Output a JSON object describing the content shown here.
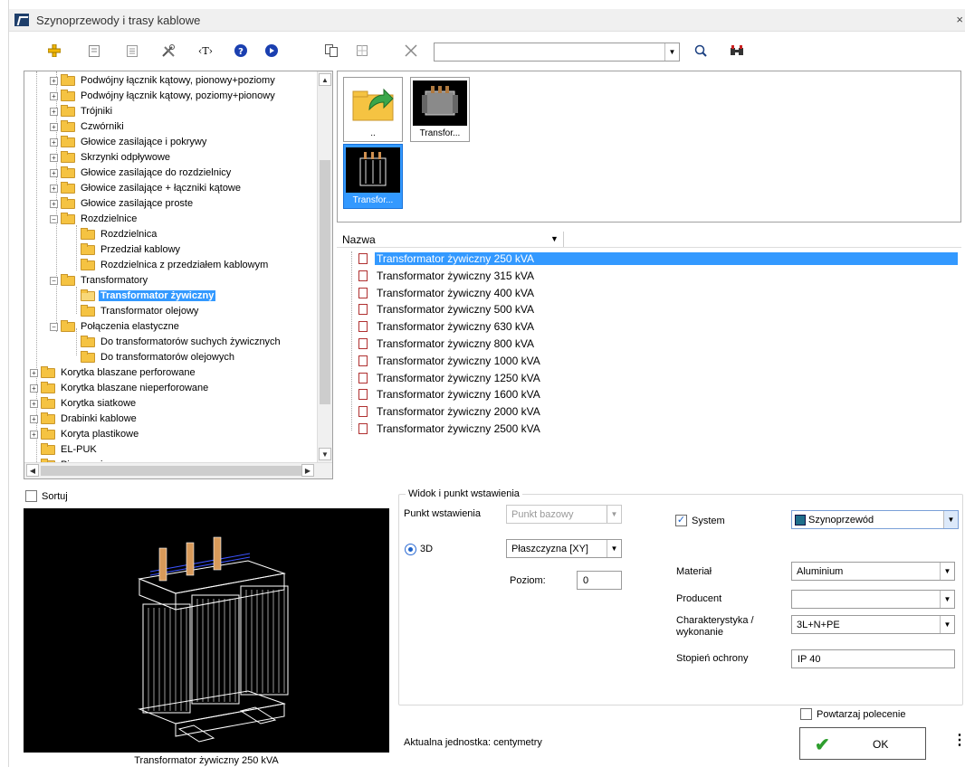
{
  "window": {
    "title": "Szynoprzewody i trasy kablowe",
    "close_glyph": "×"
  },
  "toolbar": {
    "icons": [
      "add-icon",
      "page-icon",
      "list-icon",
      "tools-icon",
      "text-tag-icon",
      "help-icon",
      "info-icon",
      "copy-icon",
      "grid-icon",
      "delete-icon",
      "search-icon",
      "binoculars-icon"
    ],
    "text_tag": "‹T›",
    "search_value": ""
  },
  "tree": {
    "items": [
      {
        "label": "Podwójny łącznik kątowy, pionowy+poziomy",
        "level": 1,
        "expander": "+"
      },
      {
        "label": "Podwójny łącznik kątowy, poziomy+pionowy",
        "level": 1,
        "expander": "+"
      },
      {
        "label": "Trójniki",
        "level": 1,
        "expander": "+"
      },
      {
        "label": "Czwórniki",
        "level": 1,
        "expander": "+"
      },
      {
        "label": "Głowice zasilające i pokrywy",
        "level": 1,
        "expander": "+"
      },
      {
        "label": "Skrzynki odpływowe",
        "level": 1,
        "expander": "+"
      },
      {
        "label": "Głowice zasilające do rozdzielnicy",
        "level": 1,
        "expander": "+"
      },
      {
        "label": "Głowice zasilające + łączniki kątowe",
        "level": 1,
        "expander": "+"
      },
      {
        "label": "Głowice zasilające proste",
        "level": 1,
        "expander": "+"
      },
      {
        "label": "Rozdzielnice",
        "level": 1,
        "expander": "−"
      },
      {
        "label": "Rozdzielnica",
        "level": 2,
        "expander": ""
      },
      {
        "label": "Przedział kablowy",
        "level": 2,
        "expander": ""
      },
      {
        "label": "Rozdzielnica z przedziałem kablowym",
        "level": 2,
        "expander": ""
      },
      {
        "label": "Transformatory",
        "level": 1,
        "expander": "−"
      },
      {
        "label": "Transformator żywiczny",
        "level": 2,
        "expander": "",
        "selected": true
      },
      {
        "label": "Transformator olejowy",
        "level": 2,
        "expander": ""
      },
      {
        "label": "Połączenia elastyczne",
        "level": 1,
        "expander": "−"
      },
      {
        "label": "Do transformatorów suchych żywicznych",
        "level": 2,
        "expander": ""
      },
      {
        "label": "Do transformatorów olejowych",
        "level": 2,
        "expander": ""
      },
      {
        "label": "Korytka blaszane perforowane",
        "level": 0,
        "expander": "+"
      },
      {
        "label": "Korytka blaszane nieperforowane",
        "level": 0,
        "expander": "+"
      },
      {
        "label": "Korytka siatkowe",
        "level": 0,
        "expander": "+"
      },
      {
        "label": "Drabinki kablowe",
        "level": 0,
        "expander": "+"
      },
      {
        "label": "Koryta plastikowe",
        "level": 0,
        "expander": "+"
      },
      {
        "label": "EL-PUK",
        "level": 0,
        "expander": ""
      },
      {
        "label": "Pipenergia",
        "level": 0,
        "expander": ""
      }
    ]
  },
  "thumbnails": [
    {
      "caption": "..",
      "icon": "folder-up-icon"
    },
    {
      "caption": "Transfor...",
      "icon": "transformer-oil-icon"
    },
    {
      "caption": "Transfor...",
      "icon": "transformer-resin-icon",
      "selected": true
    }
  ],
  "list": {
    "column_header": "Nazwa",
    "rows": [
      {
        "label": "Transformator żywiczny 250 kVA",
        "selected": true
      },
      {
        "label": "Transformator żywiczny 315 kVA"
      },
      {
        "label": "Transformator żywiczny 400 kVA"
      },
      {
        "label": "Transformator żywiczny 500 kVA"
      },
      {
        "label": "Transformator żywiczny 630 kVA"
      },
      {
        "label": "Transformator żywiczny 800 kVA"
      },
      {
        "label": "Transformator żywiczny 1000 kVA"
      },
      {
        "label": "Transformator żywiczny 1250 kVA"
      },
      {
        "label": "Transformator żywiczny 1600 kVA"
      },
      {
        "label": "Transformator żywiczny 2000 kVA"
      },
      {
        "label": "Transformator żywiczny 2500 kVA"
      }
    ]
  },
  "preview": {
    "sort_label": "Sortuj",
    "sort_checked": false,
    "caption": "Transformator żywiczny 250 kVA"
  },
  "options": {
    "group_label": "Widok i punkt wstawienia",
    "insertion_point_label": "Punkt wstawienia",
    "insertion_point_value": "Punkt bazowy",
    "mode_3d_label": "3D",
    "plane_value": "Płaszczyzna  [XY]",
    "level_label": "Poziom:",
    "level_value": "0",
    "system_label": "System",
    "system_checked": true,
    "system_value": "Szynoprzewód",
    "system_color": "#1f6f8b",
    "material_label": "Materiał",
    "material_value": "Aluminium",
    "producer_label": "Producent",
    "producer_value": "",
    "characteristics_label": "Charakterystyka / wykonanie",
    "characteristics_value": "3L+N+PE",
    "protection_label": "Stopień ochrony",
    "protection_value": "IP 40",
    "repeat_label": "Powtarzaj polecenie",
    "repeat_checked": false,
    "unit_text": "Aktualna jednostka: centymetry",
    "ok_label": "OK"
  },
  "colors": {
    "selection": "#3399ff",
    "ok_check": "#2e9e2e"
  }
}
